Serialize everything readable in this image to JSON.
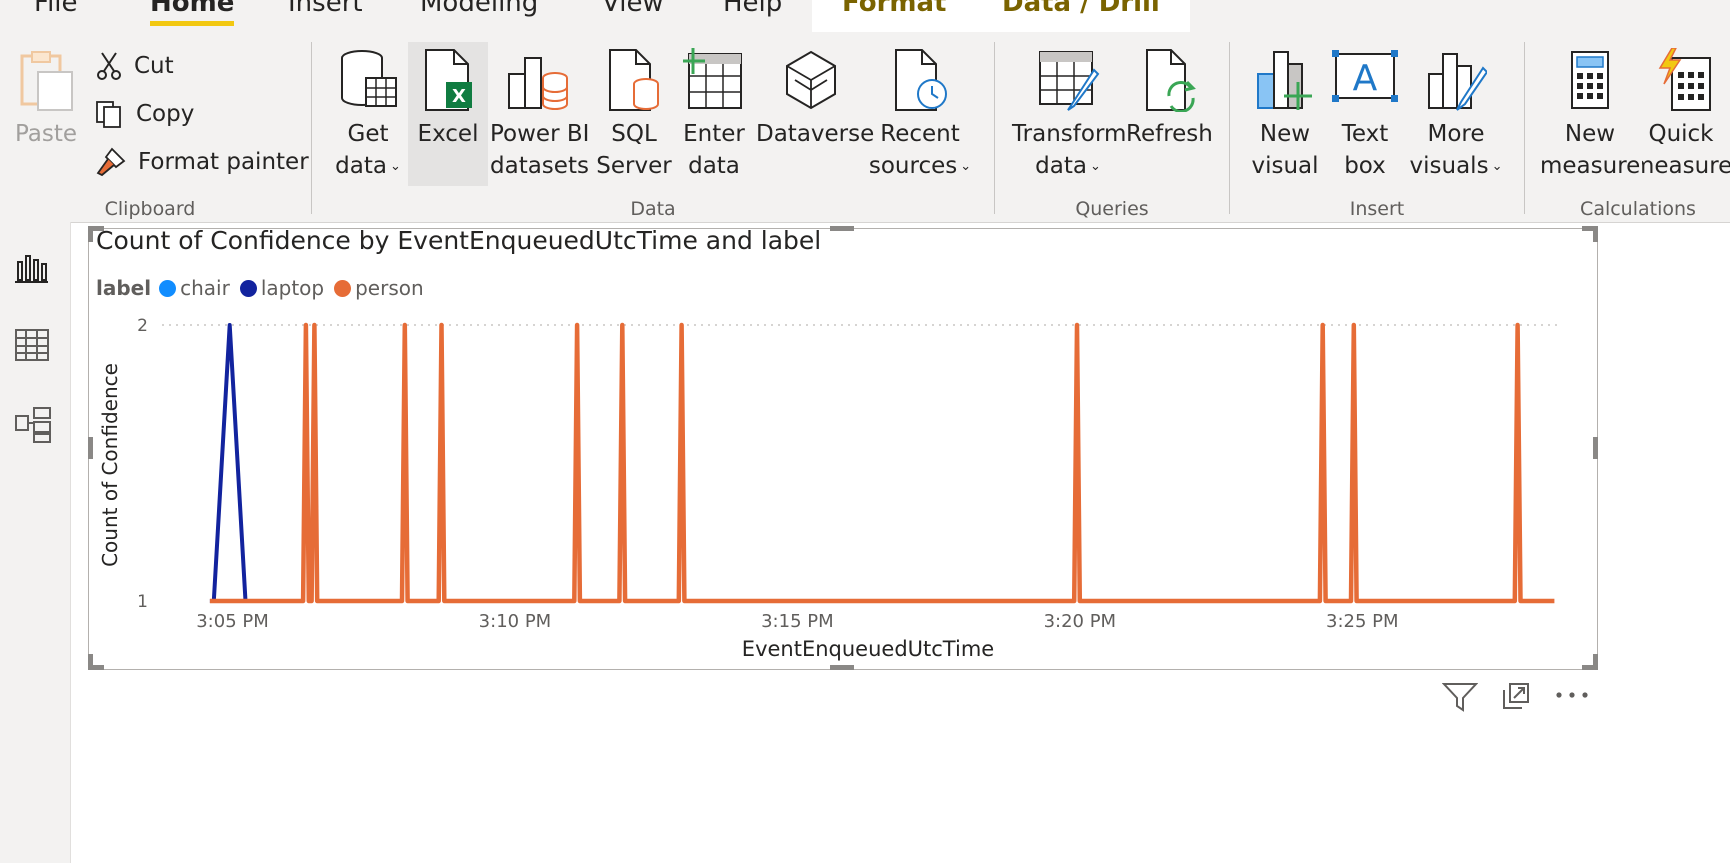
{
  "tabs": {
    "file": "File",
    "home": "Home",
    "insert": "Insert",
    "modeling": "Modeling",
    "view": "View",
    "help": "Help",
    "format": "Format",
    "data_drill": "Data / Drill"
  },
  "ribbon": {
    "clipboard": {
      "label": "Clipboard",
      "paste": "Paste",
      "cut": "Cut",
      "copy": "Copy",
      "format_painter": "Format painter"
    },
    "data": {
      "label": "Data",
      "get_data": [
        "Get",
        "data"
      ],
      "excel": "Excel",
      "power_bi_datasets": [
        "Power BI",
        "datasets"
      ],
      "sql_server": [
        "SQL",
        "Server"
      ],
      "enter_data": [
        "Enter",
        "data"
      ],
      "dataverse": "Dataverse",
      "recent_sources": [
        "Recent",
        "sources"
      ]
    },
    "queries": {
      "label": "Queries",
      "transform_data": [
        "Transform",
        "data"
      ],
      "refresh": "Refresh"
    },
    "insert": {
      "label": "Insert",
      "new_visual": [
        "New",
        "visual"
      ],
      "text_box": [
        "Text",
        "box"
      ],
      "more_visuals": [
        "More",
        "visuals"
      ]
    },
    "calculations": {
      "label": "Calculations",
      "new_measure": [
        "New",
        "measure"
      ],
      "quick_measure": [
        "Quick",
        "measure"
      ]
    }
  },
  "colors": {
    "chair": "#118dff",
    "laptop": "#12239e",
    "person": "#e66c37",
    "accent_yellow": "#f2c811",
    "ribbon_bg": "#f3f2f1"
  },
  "chart_data": {
    "type": "line",
    "title": "Count of Confidence by EventEnqueuedUtcTime and label",
    "legend_title": "label",
    "legend_placement": "top-left",
    "xlabel": "EventEnqueuedUtcTime",
    "ylabel": "Count of Confidence",
    "x_ticks": [
      "3:05 PM",
      "3:10 PM",
      "3:15 PM",
      "3:20 PM",
      "3:25 PM"
    ],
    "y_ticks": [
      "1",
      "2"
    ],
    "ylim": [
      1,
      2
    ],
    "xlim_minutes": [
      4.0,
      28.5
    ],
    "grid": "horizontal dotted at max",
    "series": [
      {
        "name": "chair",
        "spikes": []
      },
      {
        "name": "laptop",
        "baseline": 1,
        "spikes": [
          {
            "t": "3:05 PM",
            "minute": 4.95,
            "value": 2
          }
        ],
        "segment_minutes": [
          4.6,
          5.25
        ]
      },
      {
        "name": "person",
        "baseline": 1,
        "segment_minutes": [
          4.6,
          28.4
        ],
        "spikes": [
          {
            "minute": 6.3,
            "value": 2
          },
          {
            "minute": 6.45,
            "value": 2
          },
          {
            "minute": 8.05,
            "value": 2
          },
          {
            "minute": 8.7,
            "value": 2
          },
          {
            "minute": 11.1,
            "value": 2
          },
          {
            "minute": 11.9,
            "value": 2
          },
          {
            "minute": 12.95,
            "value": 2
          },
          {
            "minute": 19.95,
            "value": 2
          },
          {
            "minute": 24.3,
            "value": 2
          },
          {
            "minute": 24.85,
            "value": 2
          },
          {
            "minute": 27.75,
            "value": 2
          }
        ]
      }
    ]
  }
}
